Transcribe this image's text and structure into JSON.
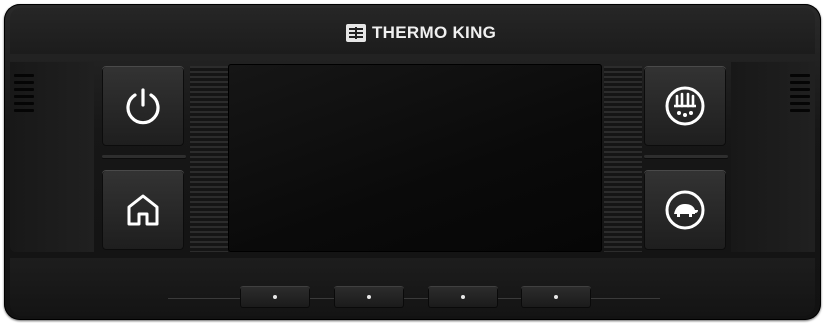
{
  "brand": {
    "name": "THERMO KING"
  },
  "colors": {
    "housing": "#171717",
    "button": "#262626",
    "icon": "#ffffff",
    "screen": "#0b0b0b"
  },
  "buttons": {
    "power": {
      "icon": "power-icon"
    },
    "home": {
      "icon": "home-icon"
    },
    "defrost": {
      "icon": "defrost-icon"
    },
    "economy": {
      "icon": "turtle-icon"
    }
  },
  "soft_keys": [
    {
      "icon": "dot-icon"
    },
    {
      "icon": "dot-icon"
    },
    {
      "icon": "dot-icon"
    },
    {
      "icon": "dot-icon"
    }
  ]
}
